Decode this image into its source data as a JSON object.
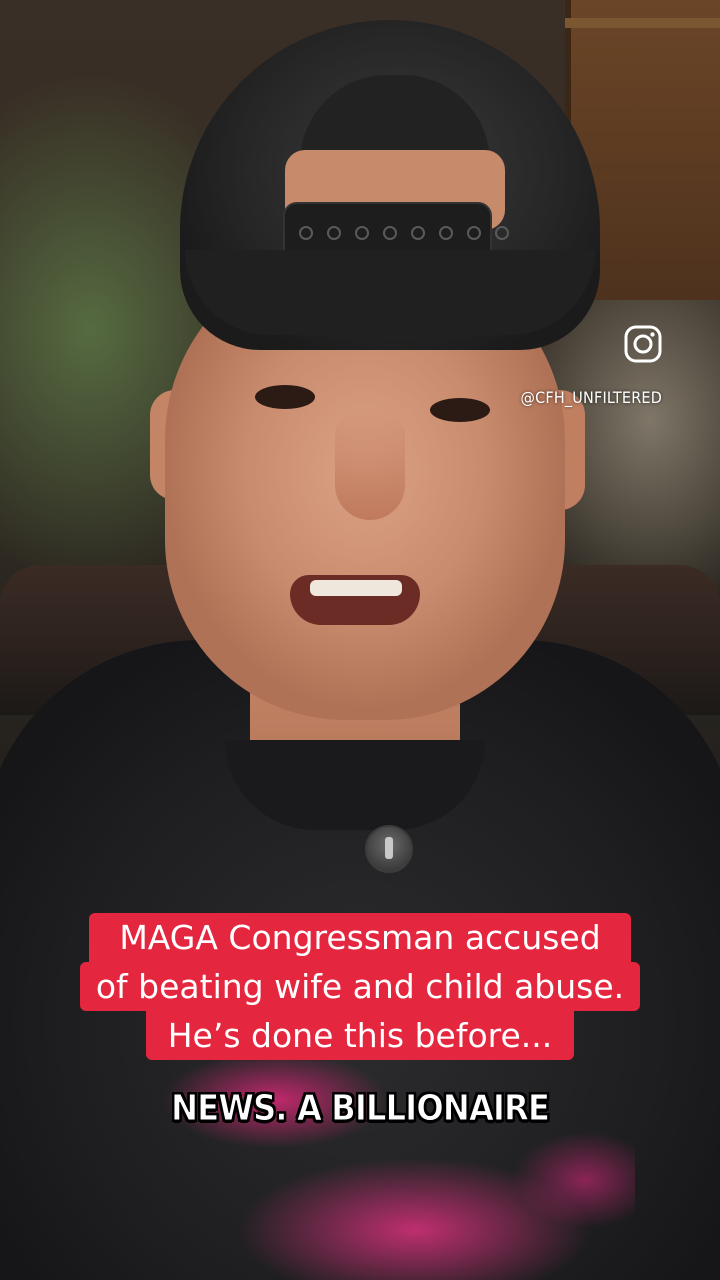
{
  "watermark": {
    "icon": "instagram-icon",
    "handle": "@CFH_UNFILTERED"
  },
  "caption": {
    "lines": [
      "MAGA Congressman accused",
      "of beating wife and child abuse.",
      "He’s done this before..."
    ],
    "background_color": "#e4263e"
  },
  "subtitle": {
    "text": "NEWS. A BILLIONAIRE"
  }
}
